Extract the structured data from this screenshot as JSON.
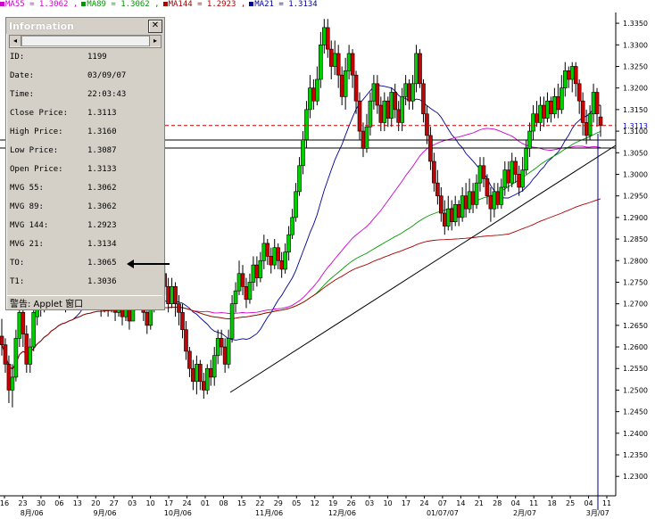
{
  "legend": [
    {
      "label": "MA55 = 1.3062 ,",
      "color": "#cc00cc"
    },
    {
      "label": "MA89 = 1.3062 ,",
      "color": "#009900"
    },
    {
      "label": "MA144 = 1.2923 ,",
      "color": "#aa0000"
    },
    {
      "label": "MA21 = 1.3134",
      "color": "#000099"
    }
  ],
  "info_panel": {
    "title": "Information",
    "close_glyph": "✕",
    "scroll_left": "◂",
    "scroll_right": "▸",
    "rows": [
      {
        "key": "ID:",
        "value": "1199"
      },
      {
        "key": "Date:",
        "value": "03/09/07"
      },
      {
        "key": "Time:",
        "value": "22:03:43"
      },
      {
        "key": "Close Price:",
        "value": "1.3113"
      },
      {
        "key": "High Price:",
        "value": "1.3160"
      },
      {
        "key": "Low Price:",
        "value": "1.3087"
      },
      {
        "key": "Open Price:",
        "value": "1.3133"
      },
      {
        "key": "MVG 55:",
        "value": "1.3062"
      },
      {
        "key": "MVG 89:",
        "value": "1.3062"
      },
      {
        "key": "MVG 144:",
        "value": "1.2923"
      },
      {
        "key": "MVG 21:",
        "value": "1.3134"
      },
      {
        "key": "TO:",
        "value": "1.3065"
      },
      {
        "key": "T1:",
        "value": "1.3036"
      }
    ],
    "footer": "警告: Applet 窗口"
  },
  "chart_data": {
    "type": "candlestick",
    "y_ticks": [
      "1.3350",
      "1.3300",
      "1.3250",
      "1.3200",
      "1.3150",
      "1.3100",
      "1.3050",
      "1.3000",
      "1.2950",
      "1.2900",
      "1.2850",
      "1.2800",
      "1.2750",
      "1.2700",
      "1.2650",
      "1.2600",
      "1.2550",
      "1.2500",
      "1.2450",
      "1.2400",
      "1.2350",
      "1.2300"
    ],
    "y_tick_values": [
      1.335,
      1.33,
      1.325,
      1.32,
      1.315,
      1.31,
      1.305,
      1.3,
      1.295,
      1.29,
      1.285,
      1.28,
      1.275,
      1.27,
      1.265,
      1.26,
      1.255,
      1.25,
      1.245,
      1.24,
      1.235,
      1.23
    ],
    "ylim": [
      1.2255,
      1.3375
    ],
    "current_price_label": "1.3113",
    "current_price": 1.3113,
    "x_day_ticks": [
      "16",
      "23",
      "30",
      "06",
      "13",
      "20",
      "27",
      "03",
      "10",
      "17",
      "24",
      "01",
      "08",
      "15",
      "22",
      "29",
      "05",
      "12",
      "19",
      "26",
      "03",
      "10",
      "17",
      "24",
      "07",
      "14",
      "21",
      "28",
      "04",
      "11",
      "18",
      "25",
      "04",
      "11"
    ],
    "x_month_labels": [
      "8月/06",
      "9月/06",
      "10月/06",
      "11月/06",
      "12月/06",
      "01/07/07",
      "2月/07",
      "3月/07"
    ],
    "candles": [
      [
        1.2625,
        1.2605,
        1.2665,
        1.258
      ],
      [
        1.2605,
        1.256,
        1.262,
        1.254
      ],
      [
        1.256,
        1.25,
        1.258,
        1.247
      ],
      [
        1.25,
        1.253,
        1.256,
        1.246
      ],
      [
        1.253,
        1.262,
        1.264,
        1.252
      ],
      [
        1.262,
        1.268,
        1.27,
        1.26
      ],
      [
        1.268,
        1.263,
        1.269,
        1.26
      ],
      [
        1.263,
        1.256,
        1.265,
        1.254
      ],
      [
        1.256,
        1.26,
        1.262,
        1.254
      ],
      [
        1.26,
        1.268,
        1.27,
        1.259
      ],
      [
        1.267,
        1.271,
        1.272,
        1.265
      ],
      [
        1.271,
        1.269,
        1.273,
        1.267
      ],
      [
        1.269,
        1.273,
        1.275,
        1.268
      ],
      [
        1.273,
        1.27,
        1.276,
        1.269
      ],
      [
        1.27,
        1.276,
        1.278,
        1.269
      ],
      [
        1.276,
        1.272,
        1.277,
        1.27
      ],
      [
        1.272,
        1.276,
        1.278,
        1.271
      ],
      [
        1.276,
        1.273,
        1.279,
        1.272
      ],
      [
        1.273,
        1.27,
        1.275,
        1.268
      ],
      [
        1.27,
        1.274,
        1.276,
        1.269
      ],
      [
        1.274,
        1.272,
        1.277,
        1.27
      ],
      [
        1.272,
        1.276,
        1.278,
        1.27
      ],
      [
        1.276,
        1.273,
        1.279,
        1.272
      ],
      [
        1.273,
        1.277,
        1.279,
        1.272
      ],
      [
        1.277,
        1.274,
        1.28,
        1.273
      ],
      [
        1.274,
        1.271,
        1.276,
        1.269
      ],
      [
        1.271,
        1.275,
        1.277,
        1.27
      ],
      [
        1.275,
        1.272,
        1.276,
        1.27
      ],
      [
        1.272,
        1.269,
        1.273,
        1.267
      ],
      [
        1.269,
        1.272,
        1.275,
        1.268
      ],
      [
        1.272,
        1.269,
        1.273,
        1.267
      ],
      [
        1.269,
        1.271,
        1.273,
        1.268
      ],
      [
        1.271,
        1.268,
        1.272,
        1.266
      ],
      [
        1.268,
        1.27,
        1.272,
        1.267
      ],
      [
        1.27,
        1.267,
        1.271,
        1.265
      ],
      [
        1.267,
        1.269,
        1.271,
        1.266
      ],
      [
        1.269,
        1.266,
        1.27,
        1.264
      ],
      [
        1.266,
        1.27,
        1.273,
        1.266
      ],
      [
        1.27,
        1.274,
        1.276,
        1.269
      ],
      [
        1.274,
        1.271,
        1.276,
        1.269
      ],
      [
        1.271,
        1.268,
        1.273,
        1.266
      ],
      [
        1.268,
        1.265,
        1.27,
        1.263
      ],
      [
        1.265,
        1.269,
        1.271,
        1.264
      ],
      [
        1.269,
        1.276,
        1.279,
        1.268
      ],
      [
        1.276,
        1.272,
        1.28,
        1.27
      ],
      [
        1.272,
        1.277,
        1.279,
        1.27
      ],
      [
        1.277,
        1.274,
        1.279,
        1.272
      ],
      [
        1.274,
        1.27,
        1.276,
        1.268
      ],
      [
        1.27,
        1.274,
        1.276,
        1.269
      ],
      [
        1.274,
        1.27,
        1.275,
        1.267
      ],
      [
        1.27,
        1.268,
        1.272,
        1.265
      ],
      [
        1.268,
        1.264,
        1.27,
        1.262
      ],
      [
        1.264,
        1.259,
        1.266,
        1.257
      ],
      [
        1.259,
        1.255,
        1.26,
        1.253
      ],
      [
        1.255,
        1.252,
        1.257,
        1.25
      ],
      [
        1.252,
        1.256,
        1.258,
        1.249
      ],
      [
        1.256,
        1.252,
        1.257,
        1.25
      ],
      [
        1.252,
        1.25,
        1.254,
        1.248
      ],
      [
        1.25,
        1.255,
        1.256,
        1.249
      ],
      [
        1.255,
        1.253,
        1.257,
        1.251
      ],
      [
        1.253,
        1.258,
        1.26,
        1.251
      ],
      [
        1.258,
        1.262,
        1.264,
        1.256
      ],
      [
        1.262,
        1.26,
        1.264,
        1.258
      ],
      [
        1.26,
        1.256,
        1.262,
        1.254
      ],
      [
        1.256,
        1.262,
        1.264,
        1.255
      ],
      [
        1.262,
        1.27,
        1.272,
        1.261
      ],
      [
        1.27,
        1.273,
        1.275,
        1.268
      ],
      [
        1.273,
        1.277,
        1.28,
        1.272
      ],
      [
        1.277,
        1.274,
        1.279,
        1.272
      ],
      [
        1.274,
        1.271,
        1.276,
        1.269
      ],
      [
        1.271,
        1.275,
        1.277,
        1.27
      ],
      [
        1.275,
        1.279,
        1.281,
        1.273
      ],
      [
        1.279,
        1.276,
        1.281,
        1.274
      ],
      [
        1.276,
        1.28,
        1.282,
        1.275
      ],
      [
        1.28,
        1.284,
        1.286,
        1.278
      ],
      [
        1.284,
        1.281,
        1.285,
        1.279
      ],
      [
        1.281,
        1.279,
        1.283,
        1.277
      ],
      [
        1.279,
        1.283,
        1.285,
        1.278
      ],
      [
        1.283,
        1.28,
        1.284,
        1.278
      ],
      [
        1.28,
        1.278,
        1.282,
        1.276
      ],
      [
        1.278,
        1.282,
        1.284,
        1.277
      ],
      [
        1.282,
        1.286,
        1.288,
        1.28
      ],
      [
        1.286,
        1.29,
        1.292,
        1.285
      ],
      [
        1.29,
        1.296,
        1.298,
        1.289
      ],
      [
        1.296,
        1.302,
        1.304,
        1.295
      ],
      [
        1.302,
        1.308,
        1.31,
        1.3
      ],
      [
        1.308,
        1.315,
        1.317,
        1.306
      ],
      [
        1.315,
        1.32,
        1.323,
        1.313
      ],
      [
        1.32,
        1.317,
        1.322,
        1.315
      ],
      [
        1.317,
        1.322,
        1.325,
        1.316
      ],
      [
        1.322,
        1.33,
        1.333,
        1.32
      ],
      [
        1.33,
        1.334,
        1.336,
        1.328
      ],
      [
        1.334,
        1.329,
        1.336,
        1.327
      ],
      [
        1.329,
        1.325,
        1.331,
        1.322
      ],
      [
        1.325,
        1.328,
        1.331,
        1.323
      ],
      [
        1.328,
        1.323,
        1.33,
        1.32
      ],
      [
        1.323,
        1.318,
        1.325,
        1.316
      ],
      [
        1.318,
        1.324,
        1.327,
        1.315
      ],
      [
        1.324,
        1.328,
        1.33,
        1.322
      ],
      [
        1.328,
        1.323,
        1.329,
        1.32
      ],
      [
        1.323,
        1.317,
        1.324,
        1.314
      ],
      [
        1.317,
        1.31,
        1.319,
        1.308
      ],
      [
        1.31,
        1.306,
        1.312,
        1.304
      ],
      [
        1.306,
        1.311,
        1.314,
        1.305
      ],
      [
        1.311,
        1.317,
        1.319,
        1.309
      ],
      [
        1.317,
        1.321,
        1.323,
        1.315
      ],
      [
        1.321,
        1.316,
        1.323,
        1.314
      ],
      [
        1.316,
        1.312,
        1.318,
        1.31
      ],
      [
        1.312,
        1.317,
        1.319,
        1.31
      ],
      [
        1.317,
        1.313,
        1.318,
        1.311
      ],
      [
        1.313,
        1.319,
        1.32,
        1.311
      ],
      [
        1.319,
        1.315,
        1.321,
        1.313
      ],
      [
        1.315,
        1.312,
        1.317,
        1.31
      ],
      [
        1.312,
        1.318,
        1.32,
        1.31
      ],
      [
        1.318,
        1.321,
        1.323,
        1.316
      ],
      [
        1.321,
        1.317,
        1.322,
        1.315
      ],
      [
        1.317,
        1.321,
        1.323,
        1.315
      ],
      [
        1.321,
        1.328,
        1.33,
        1.319
      ],
      [
        1.328,
        1.321,
        1.329,
        1.32
      ],
      [
        1.321,
        1.314,
        1.322,
        1.312
      ],
      [
        1.314,
        1.309,
        1.316,
        1.307
      ],
      [
        1.309,
        1.303,
        1.311,
        1.301
      ],
      [
        1.303,
        1.298,
        1.305,
        1.296
      ],
      [
        1.298,
        1.295,
        1.301,
        1.293
      ],
      [
        1.295,
        1.291,
        1.297,
        1.289
      ],
      [
        1.291,
        1.288,
        1.294,
        1.286
      ],
      [
        1.288,
        1.292,
        1.295,
        1.287
      ],
      [
        1.292,
        1.289,
        1.294,
        1.287
      ],
      [
        1.289,
        1.293,
        1.295,
        1.288
      ],
      [
        1.293,
        1.29,
        1.294,
        1.288
      ],
      [
        1.29,
        1.295,
        1.297,
        1.289
      ],
      [
        1.295,
        1.292,
        1.298,
        1.29
      ],
      [
        1.292,
        1.296,
        1.299,
        1.291
      ],
      [
        1.296,
        1.293,
        1.298,
        1.291
      ],
      [
        1.293,
        1.298,
        1.3,
        1.292
      ],
      [
        1.298,
        1.302,
        1.304,
        1.296
      ],
      [
        1.302,
        1.299,
        1.304,
        1.297
      ],
      [
        1.299,
        1.295,
        1.3,
        1.293
      ],
      [
        1.295,
        1.292,
        1.297,
        1.289
      ],
      [
        1.292,
        1.296,
        1.298,
        1.29
      ],
      [
        1.296,
        1.293,
        1.298,
        1.292
      ],
      [
        1.293,
        1.297,
        1.299,
        1.292
      ],
      [
        1.297,
        1.301,
        1.303,
        1.295
      ],
      [
        1.301,
        1.298,
        1.303,
        1.296
      ],
      [
        1.298,
        1.303,
        1.305,
        1.297
      ],
      [
        1.303,
        1.3,
        1.304,
        1.298
      ],
      [
        1.3,
        1.297,
        1.302,
        1.295
      ],
      [
        1.297,
        1.301,
        1.304,
        1.296
      ],
      [
        1.301,
        1.306,
        1.308,
        1.3
      ],
      [
        1.306,
        1.31,
        1.312,
        1.304
      ],
      [
        1.31,
        1.314,
        1.316,
        1.308
      ],
      [
        1.314,
        1.312,
        1.317,
        1.311
      ],
      [
        1.312,
        1.316,
        1.318,
        1.31
      ],
      [
        1.316,
        1.313,
        1.318,
        1.311
      ],
      [
        1.313,
        1.317,
        1.319,
        1.312
      ],
      [
        1.317,
        1.314,
        1.318,
        1.312
      ],
      [
        1.314,
        1.318,
        1.32,
        1.313
      ],
      [
        1.318,
        1.315,
        1.321,
        1.313
      ],
      [
        1.315,
        1.32,
        1.323,
        1.314
      ],
      [
        1.32,
        1.324,
        1.326,
        1.318
      ],
      [
        1.324,
        1.322,
        1.325,
        1.32
      ],
      [
        1.322,
        1.325,
        1.326,
        1.319
      ],
      [
        1.325,
        1.321,
        1.326,
        1.318
      ],
      [
        1.321,
        1.317,
        1.322,
        1.314
      ],
      [
        1.317,
        1.312,
        1.319,
        1.309
      ],
      [
        1.312,
        1.309,
        1.315,
        1.307
      ],
      [
        1.309,
        1.314,
        1.316,
        1.308
      ],
      [
        1.314,
        1.319,
        1.321,
        1.312
      ],
      [
        1.319,
        1.314,
        1.32,
        1.311
      ],
      [
        1.3133,
        1.3113,
        1.316,
        1.3087
      ]
    ]
  }
}
